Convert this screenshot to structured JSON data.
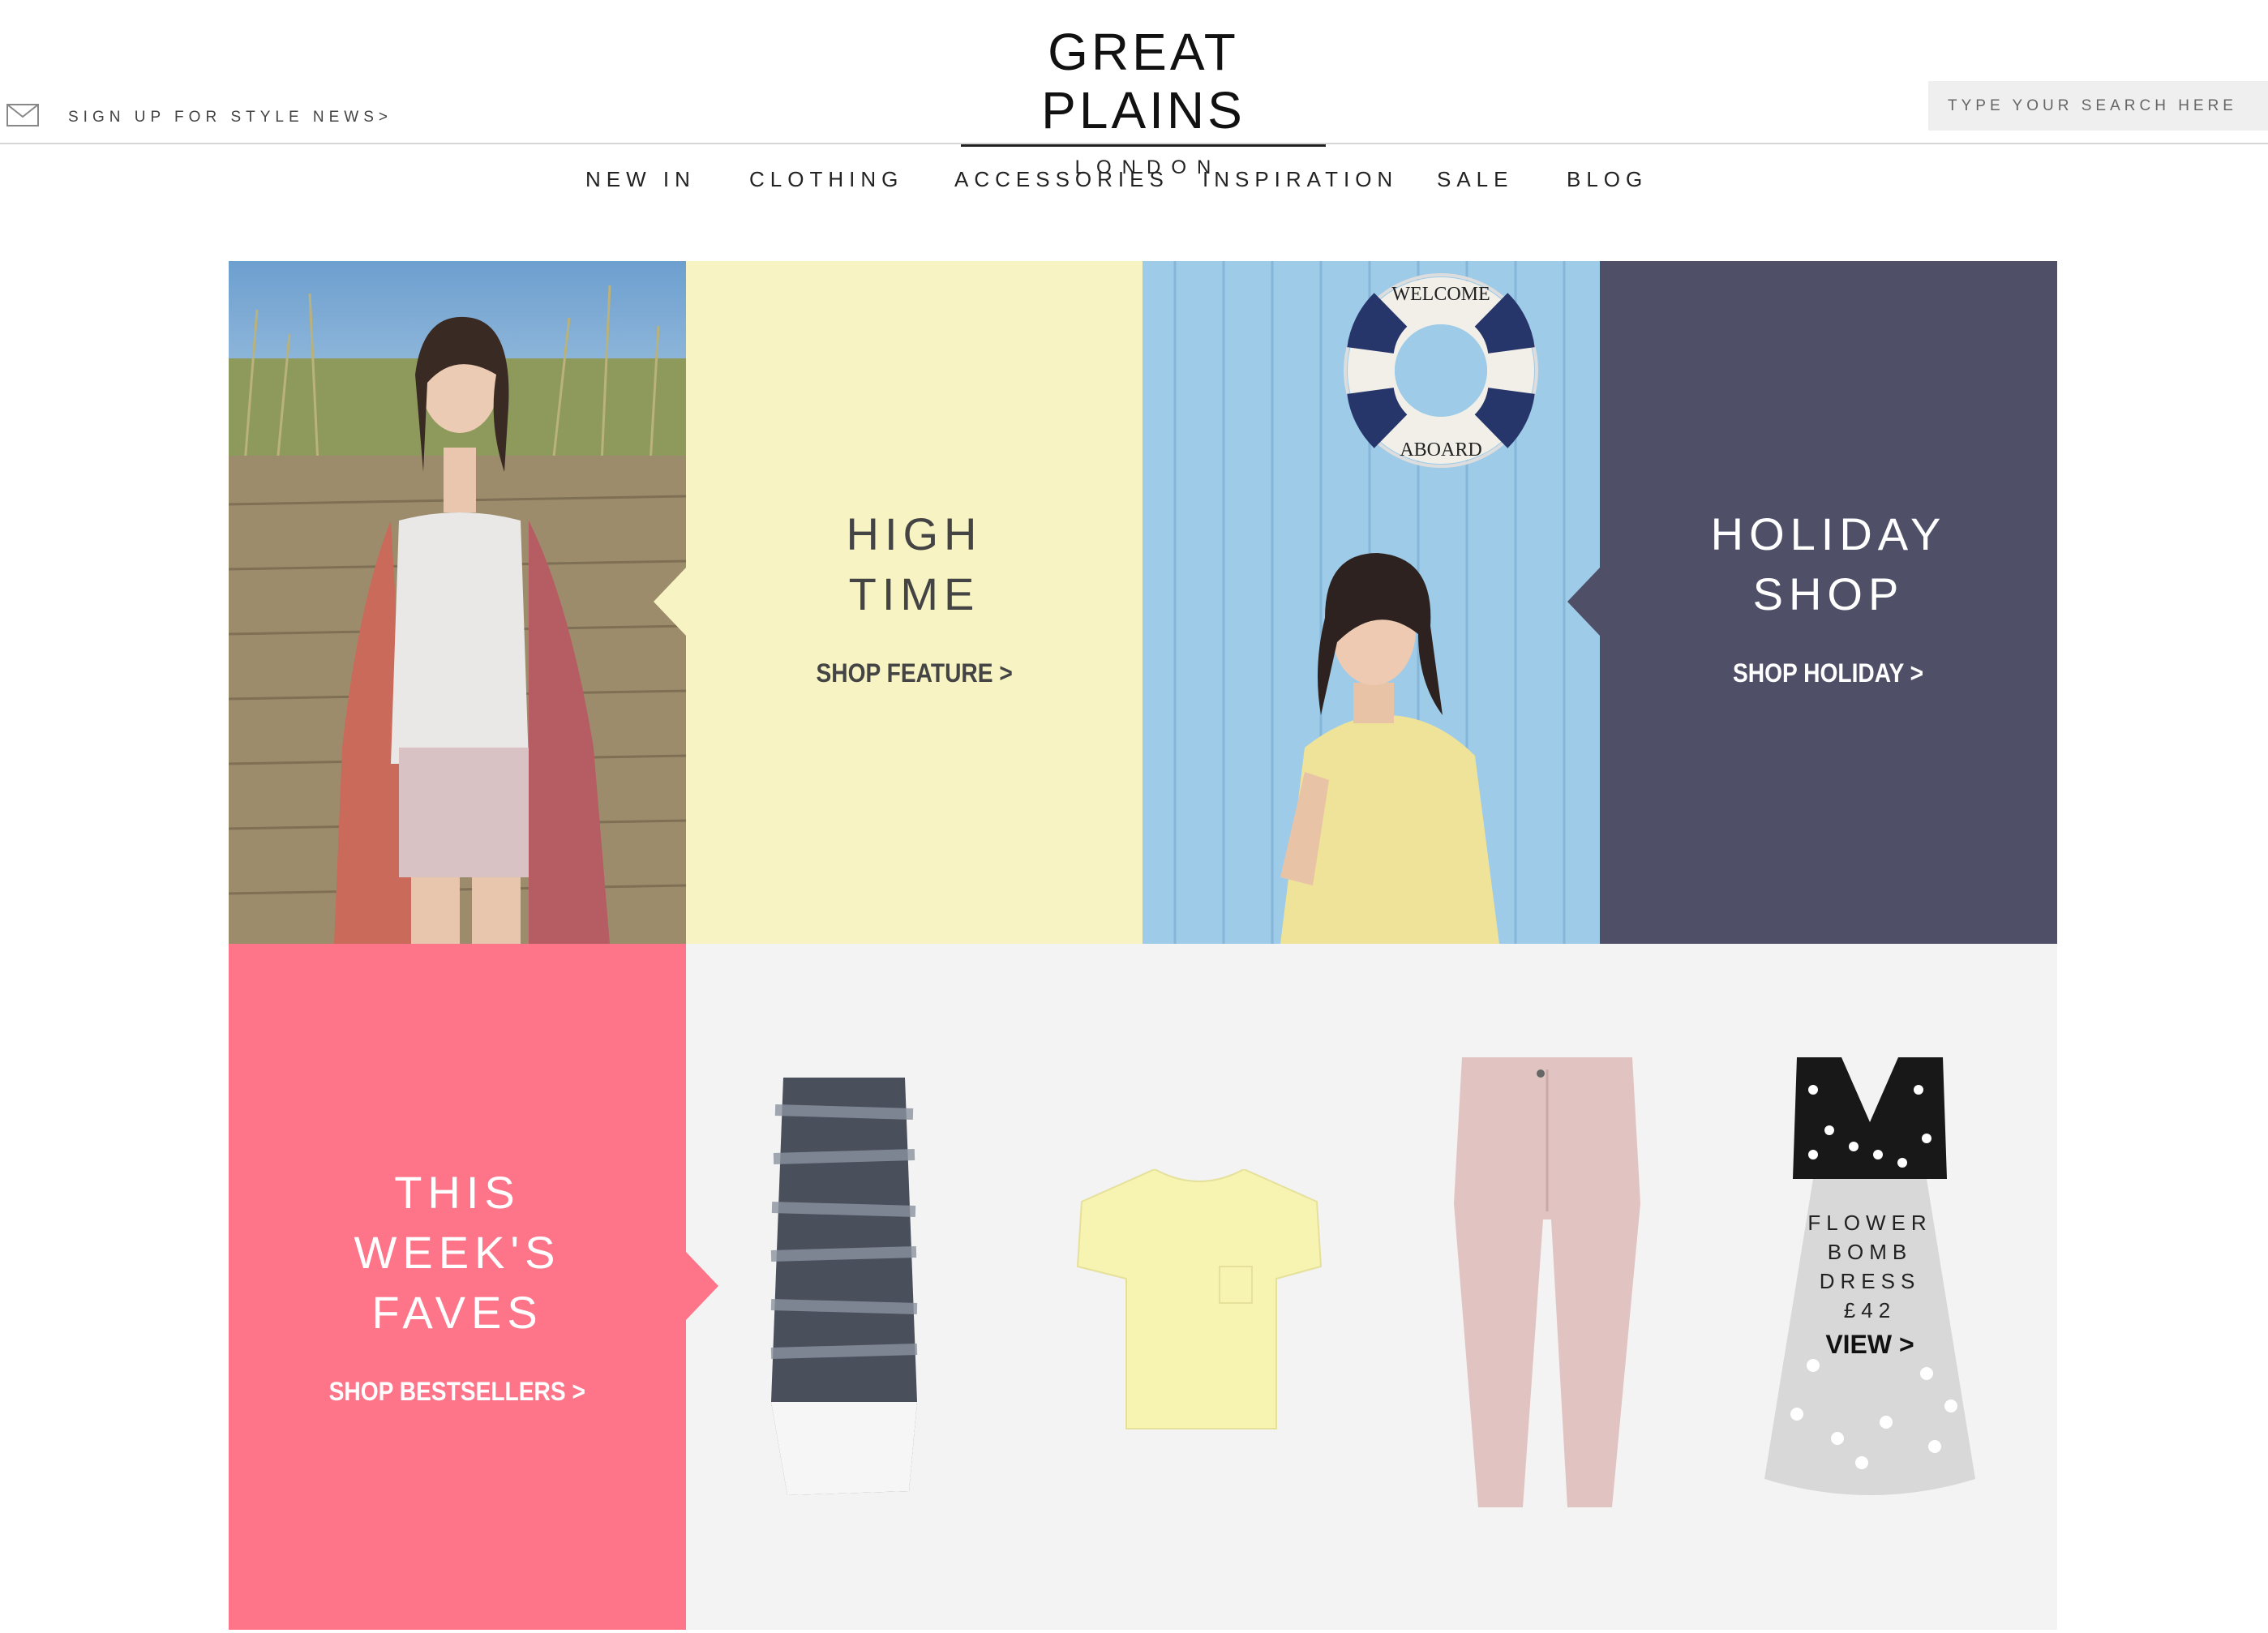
{
  "brand": {
    "name": "GREAT PLAINS",
    "sub": "LONDON"
  },
  "signup": {
    "label": "SIGN UP FOR STYLE NEWS>"
  },
  "search": {
    "placeholder": "TYPE YOUR SEARCH HERE"
  },
  "nav": {
    "items": [
      {
        "label": "NEW IN"
      },
      {
        "label": "CLOTHING"
      },
      {
        "label": "ACCESSORIES"
      },
      {
        "label": "INSPIRATION"
      },
      {
        "label": "SALE"
      },
      {
        "label": "BLOG"
      }
    ]
  },
  "promos": {
    "high_time": {
      "title_line1": "HIGH",
      "title_line2": "TIME",
      "link": "SHOP FEATURE >"
    },
    "holiday": {
      "title_line1": "HOLIDAY",
      "title_line2": "SHOP",
      "link": "SHOP HOLIDAY >"
    },
    "faves": {
      "title_line1": "THIS",
      "title_line2": "WEEK'S",
      "title_line3": "FAVES",
      "link": "SHOP BESTSELLERS >"
    }
  },
  "lifebuoy": {
    "text_top": "WELCOME",
    "text_bottom": "ABOARD"
  },
  "product": {
    "line1": "FLOWER",
    "line2": "BOMB",
    "line3": "DRESS",
    "price": "£42",
    "link": "VIEW >"
  },
  "colors": {
    "yellow": "#f7f3c3",
    "navy": "#4f5068",
    "pink": "#fe7489",
    "sky": "#9ecbe8",
    "light_gray": "#f3f3f3"
  }
}
